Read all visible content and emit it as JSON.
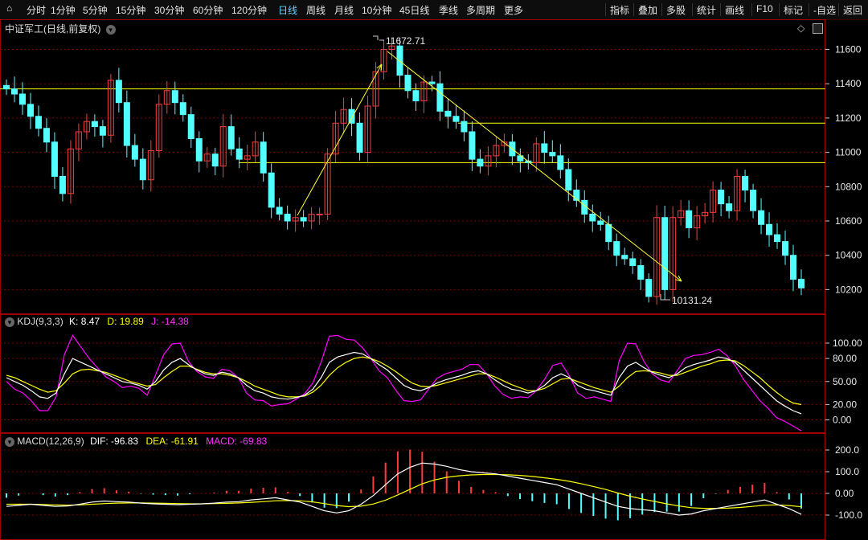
{
  "toolbar": {
    "left": [
      "分时",
      "1分钟",
      "5分钟",
      "15分钟",
      "30分钟",
      "60分钟",
      "120分钟",
      "日线",
      "周线",
      "月线",
      "10分钟",
      "45日线",
      "季线",
      "多周期",
      "更多"
    ],
    "active": "日线",
    "right": [
      "指标",
      "叠加",
      "多股",
      "统计",
      "画线",
      "F10",
      "标记",
      "-自选",
      "返回"
    ]
  },
  "main": {
    "title": "中证军工(日线,前复权)",
    "high_label": "11672.71",
    "low_label": "10131.24",
    "yticks": [
      "11600",
      "11400",
      "11200",
      "11000",
      "10800",
      "10600",
      "10400",
      "10200"
    ]
  },
  "kdj": {
    "name": "KDJ(9,3,3)",
    "k": "K: 8.47",
    "d": "D: 19.89",
    "j": "J: -14.38",
    "yticks": [
      "100.00",
      "80.00",
      "50.00",
      "20.00",
      "0.00"
    ]
  },
  "macd": {
    "name": "MACD(12,26,9)",
    "dif": "DIF: -96.83",
    "dea": "DEA: -61.91",
    "macd": "MACD: -69.83",
    "yticks": [
      "200.0",
      "100.0",
      "0.00",
      "-100.0"
    ]
  },
  "colors": {
    "up": "#ff3b3b",
    "down": "#54ffff",
    "k_line": "#ffffff",
    "d_line": "#ffff00",
    "j_line": "#ff00ff",
    "grid": "#7a0000",
    "border": "#a00000"
  },
  "chart_data": {
    "type": "candlestick",
    "horizontal_levels": [
      11370,
      11170,
      10940
    ],
    "candles_close": [
      11370,
      11340,
      11280,
      11210,
      11140,
      11060,
      10860,
      10760,
      11020,
      11120,
      11180,
      11150,
      11100,
      11420,
      11290,
      11040,
      10960,
      10840,
      11010,
      11280,
      11360,
      11290,
      11220,
      11080,
      10950,
      10990,
      10920,
      11150,
      11020,
      10960,
      10980,
      11060,
      10880,
      10680,
      10640,
      10600,
      10620,
      10600,
      10640,
      10640,
      10990,
      11170,
      11250,
      11170,
      11000,
      11270,
      11470,
      11600,
      11620,
      11450,
      11360,
      11300,
      11410,
      11400,
      11240,
      11210,
      11180,
      11120,
      10960,
      10920,
      10980,
      11040,
      11060,
      10980,
      10950,
      10940,
      11050,
      11000,
      10980,
      10900,
      10780,
      10720,
      10640,
      10600,
      10580,
      10480,
      10400,
      10380,
      10340,
      10260,
      10160,
      10620,
      10200,
      10620,
      10660,
      10560,
      10630,
      10650,
      10780,
      10700,
      10660,
      10860,
      10780,
      10660,
      10580,
      10520,
      10480,
      10400,
      10260,
      10210
    ],
    "kdj_k": [
      55,
      50,
      45,
      38,
      30,
      28,
      35,
      60,
      80,
      75,
      70,
      65,
      60,
      55,
      50,
      48,
      45,
      40,
      50,
      65,
      75,
      80,
      72,
      65,
      60,
      58,
      62,
      60,
      55,
      45,
      38,
      35,
      30,
      28,
      27,
      29,
      32,
      40,
      55,
      75,
      82,
      85,
      88,
      86,
      80,
      72,
      65,
      55,
      45,
      40,
      38,
      42,
      48,
      52,
      55,
      58,
      62,
      64,
      60,
      52,
      45,
      40,
      38,
      35,
      38,
      45,
      55,
      60,
      55,
      45,
      40,
      38,
      35,
      32,
      55,
      70,
      75,
      68,
      62,
      58,
      55,
      60,
      68,
      72,
      75,
      78,
      82,
      80,
      75,
      65,
      55,
      45,
      35,
      25,
      18,
      12,
      8
    ],
    "kdj_d": [
      58,
      55,
      50,
      45,
      40,
      36,
      38,
      48,
      60,
      65,
      66,
      64,
      62,
      58,
      54,
      50,
      47,
      44,
      46,
      55,
      63,
      70,
      70,
      66,
      62,
      60,
      60,
      58,
      55,
      50,
      44,
      40,
      36,
      32,
      30,
      30,
      31,
      36,
      45,
      58,
      68,
      75,
      80,
      82,
      80,
      76,
      70,
      63,
      55,
      48,
      44,
      43,
      45,
      48,
      51,
      54,
      57,
      60,
      60,
      56,
      51,
      46,
      42,
      38,
      38,
      41,
      47,
      53,
      54,
      50,
      46,
      42,
      39,
      36,
      44,
      55,
      63,
      64,
      63,
      61,
      58,
      58,
      62,
      66,
      70,
      73,
      77,
      78,
      77,
      71,
      63,
      55,
      45,
      36,
      28,
      22,
      19.89
    ],
    "kdj_j": [
      50,
      40,
      35,
      25,
      12,
      12,
      30,
      85,
      110,
      95,
      80,
      68,
      56,
      50,
      42,
      44,
      41,
      32,
      58,
      85,
      99,
      100,
      76,
      63,
      56,
      54,
      66,
      64,
      55,
      35,
      26,
      25,
      18,
      20,
      21,
      27,
      34,
      48,
      75,
      109,
      110,
      105,
      104,
      94,
      80,
      64,
      55,
      39,
      25,
      24,
      26,
      40,
      54,
      60,
      63,
      66,
      72,
      72,
      60,
      44,
      33,
      28,
      30,
      29,
      38,
      53,
      71,
      74,
      57,
      35,
      28,
      30,
      27,
      24,
      77,
      100,
      99,
      76,
      60,
      52,
      49,
      64,
      80,
      84,
      85,
      88,
      92,
      84,
      71,
      53,
      39,
      25,
      15,
      3,
      -2,
      -8,
      -14.38
    ],
    "macd_dif": [
      -60,
      -55,
      -50,
      -55,
      -60,
      -58,
      -50,
      -40,
      -35,
      -38,
      -40,
      -45,
      -48,
      -50,
      -52,
      -50,
      -48,
      -45,
      -40,
      -38,
      -30,
      -25,
      -20,
      -30,
      -40,
      -60,
      -80,
      -90,
      -80,
      -50,
      -10,
      40,
      90,
      120,
      140,
      135,
      125,
      110,
      100,
      95,
      90,
      80,
      70,
      60,
      50,
      40,
      20,
      0,
      -20,
      -40,
      -60,
      -70,
      -75,
      -80,
      -90,
      -100,
      -95,
      -80,
      -70,
      -60,
      -50,
      -40,
      -30,
      -50,
      -70,
      -96.83
    ],
    "macd_dea": [
      -50,
      -50,
      -50,
      -51,
      -53,
      -54,
      -53,
      -50,
      -47,
      -45,
      -44,
      -44,
      -45,
      -46,
      -47,
      -48,
      -48,
      -47,
      -46,
      -44,
      -41,
      -38,
      -34,
      -33,
      -34,
      -39,
      -47,
      -56,
      -61,
      -59,
      -49,
      -31,
      -7,
      19,
      44,
      62,
      74,
      81,
      85,
      87,
      87,
      86,
      83,
      78,
      72,
      65,
      56,
      45,
      32,
      18,
      2,
      -13,
      -26,
      -37,
      -48,
      -58,
      -66,
      -69,
      -69,
      -68,
      -65,
      -60,
      -54,
      -53,
      -56,
      -61.91
    ],
    "macd_hist": [
      -20,
      -10,
      0,
      -8,
      -14,
      -8,
      6,
      20,
      24,
      14,
      8,
      -2,
      -6,
      -8,
      -10,
      -4,
      0,
      4,
      12,
      12,
      22,
      26,
      28,
      6,
      -12,
      -42,
      -66,
      -68,
      -38,
      18,
      78,
      142,
      194,
      202,
      192,
      146,
      102,
      58,
      30,
      16,
      6,
      -12,
      -26,
      -36,
      -44,
      -50,
      -72,
      -90,
      -104,
      -116,
      -124,
      -114,
      -98,
      -86,
      -84,
      -84,
      -58,
      -22,
      -2,
      16,
      30,
      40,
      48,
      6,
      -28,
      -69.83
    ]
  }
}
